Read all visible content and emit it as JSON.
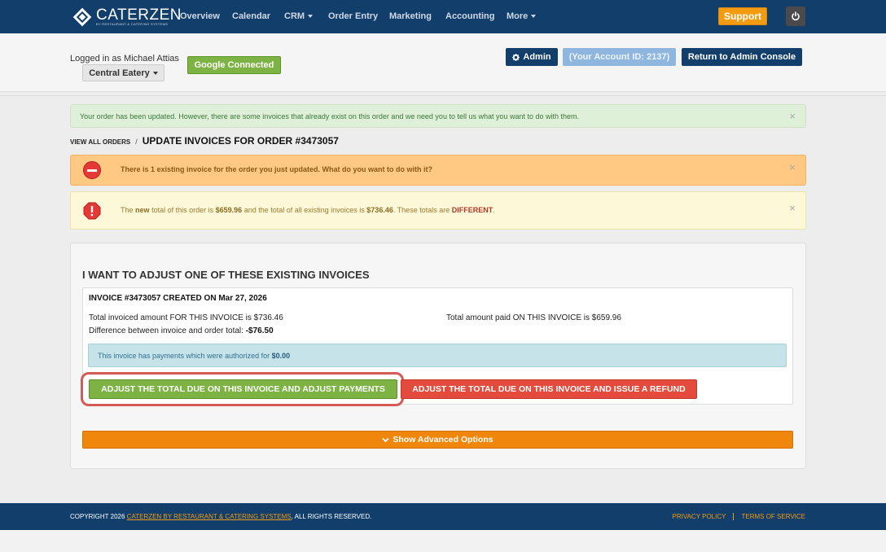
{
  "brand": {
    "name": "CATERZEN",
    "tagline": "BY RESTAURANT & CATERING SYSTEMS"
  },
  "nav": {
    "items": [
      "Overview",
      "Calendar",
      "CRM",
      "Order Entry",
      "Marketing",
      "Accounting",
      "More"
    ],
    "support_label": "Support"
  },
  "header": {
    "logged_in_text": "Logged in as Michael Attias",
    "location_label": "Central Eatery",
    "google_label": "Google Connected",
    "admin_label": "Admin",
    "account_id_label": "(Your Account ID: 2137)",
    "console_label": "Return to Admin Console"
  },
  "alerts": {
    "success": "Your order has been updated. However, there are some invoices that already exist on this order and we need you to tell us what you want to do with them.",
    "warning": "There is 1 existing invoice for the order you just updated. What do you want to do with it?",
    "info": {
      "part1": "The",
      "new_word": "new",
      "part2": "total of this order is",
      "new_total": "$659.96",
      "part3": "and the total of all existing invoices is",
      "invoice_total": "$736.46",
      "part4": ". These totals are",
      "different": "DIFFERENT",
      "end": "."
    },
    "close_symbol": "×"
  },
  "breadcrumb": {
    "link": "VIEW ALL ORDERS",
    "separator": "/",
    "title": "UPDATE INVOICES FOR ORDER #3473057"
  },
  "panel": {
    "heading": "I WANT TO ADJUST ONE OF THESE EXISTING INVOICES",
    "invoice_title": "INVOICE #3473057 CREATED ON Mar 27, 2026",
    "invoiced_amount": "Total invoiced amount FOR THIS INVOICE is $736.46",
    "amount_paid": "Total amount paid ON THIS INVOICE is $659.96",
    "difference_label": "Difference between invoice and order total:",
    "difference_value": "-$76.50",
    "note_text": "This invoice has payments which were authorized for",
    "note_amount": "$0.00",
    "btn_adjust": "ADJUST THE TOTAL DUE ON THIS INVOICE AND ADJUST PAYMENTS",
    "btn_refund": "ADJUST THE TOTAL DUE ON THIS INVOICE AND ISSUE A REFUND",
    "btn_advanced": "Show Advanced Options"
  },
  "footer": {
    "copyright_prefix": "COPYRIGHT 2026",
    "copyright_link": "CATERZEN BY RESTAURANT & CATERING SYSTEMS",
    "copyright_suffix": ", ALL RIGHTS RESERVED.",
    "privacy": "PRIVACY POLICY",
    "terms": "TERMS OF SERVICE"
  },
  "colors": {
    "navy": "#113e6b",
    "orange": "#f39c12",
    "green": "#7cb342",
    "red": "#e54b3c"
  }
}
